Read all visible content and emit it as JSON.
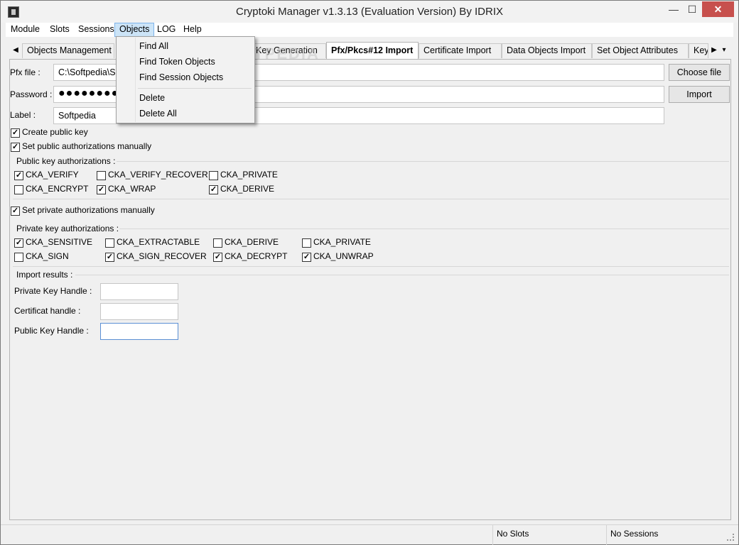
{
  "window": {
    "title": "Cryptoki Manager v1.3.13  (Evaluation Version)  By IDRIX",
    "min_glyph": "—",
    "max_glyph": "☐",
    "close_glyph": "✕"
  },
  "menubar": [
    "Module",
    "Slots",
    "Sessions",
    "Objects",
    "LOG",
    "Help"
  ],
  "tabs": {
    "scroll_left": "◀",
    "scroll_right": "▶",
    "overflow": "▾",
    "items": [
      "Objects Management",
      "Key Generation",
      "Pfx/Pkcs#12 Import",
      "Certificate Import",
      "Data Objects Import",
      "Set Object Attributes",
      "Key"
    ],
    "selected": "Pfx/Pkcs#12 Import"
  },
  "form": {
    "pfx_label": "Pfx file :",
    "pfx_value": "C:\\Softpedia\\Softpedia",
    "password_label": "Password :",
    "password_value": "●●●●●●●●●",
    "label_label": "Label :",
    "label_value": "Softpedia",
    "choose_button": "Choose file",
    "import_button": "Import"
  },
  "options": {
    "create_public_key": {
      "label": "Create public key",
      "checked": true
    },
    "set_public_manual": {
      "label": "Set public authorizations manually",
      "checked": true
    },
    "set_private_manual": {
      "label": "Set private authorizations manually",
      "checked": true
    }
  },
  "public_auth": {
    "title": "Public key authorizations :",
    "items": [
      {
        "label": "CKA_VERIFY",
        "checked": true
      },
      {
        "label": "CKA_VERIFY_RECOVER",
        "checked": false
      },
      {
        "label": "CKA_PRIVATE",
        "checked": false
      },
      {
        "label": "CKA_ENCRYPT",
        "checked": false
      },
      {
        "label": "CKA_WRAP",
        "checked": true
      },
      {
        "label": "CKA_DERIVE",
        "checked": true
      }
    ]
  },
  "private_auth": {
    "title": "Private key authorizations :",
    "items": [
      {
        "label": "CKA_SENSITIVE",
        "checked": true
      },
      {
        "label": "CKA_EXTRACTABLE",
        "checked": false
      },
      {
        "label": "CKA_DERIVE",
        "checked": false
      },
      {
        "label": "CKA_PRIVATE",
        "checked": false
      },
      {
        "label": "CKA_SIGN",
        "checked": false
      },
      {
        "label": "CKA_SIGN_RECOVER",
        "checked": true
      },
      {
        "label": "CKA_DECRYPT",
        "checked": true
      },
      {
        "label": "CKA_UNWRAP",
        "checked": true
      }
    ]
  },
  "results": {
    "title": "Import results :",
    "private_handle_label": "Private Key Handle :",
    "private_handle_value": "",
    "cert_handle_label": "Certificat handle :",
    "cert_handle_value": "",
    "public_handle_label": "Public Key Handle :",
    "public_handle_value": ""
  },
  "objects_menu": {
    "items": [
      "Find All",
      "Find Token Objects",
      "Find Session Objects",
      "Delete",
      "Delete All"
    ]
  },
  "status": {
    "slots": "No Slots",
    "sessions": "No Sessions"
  },
  "watermark": "SOFTPEDIA"
}
